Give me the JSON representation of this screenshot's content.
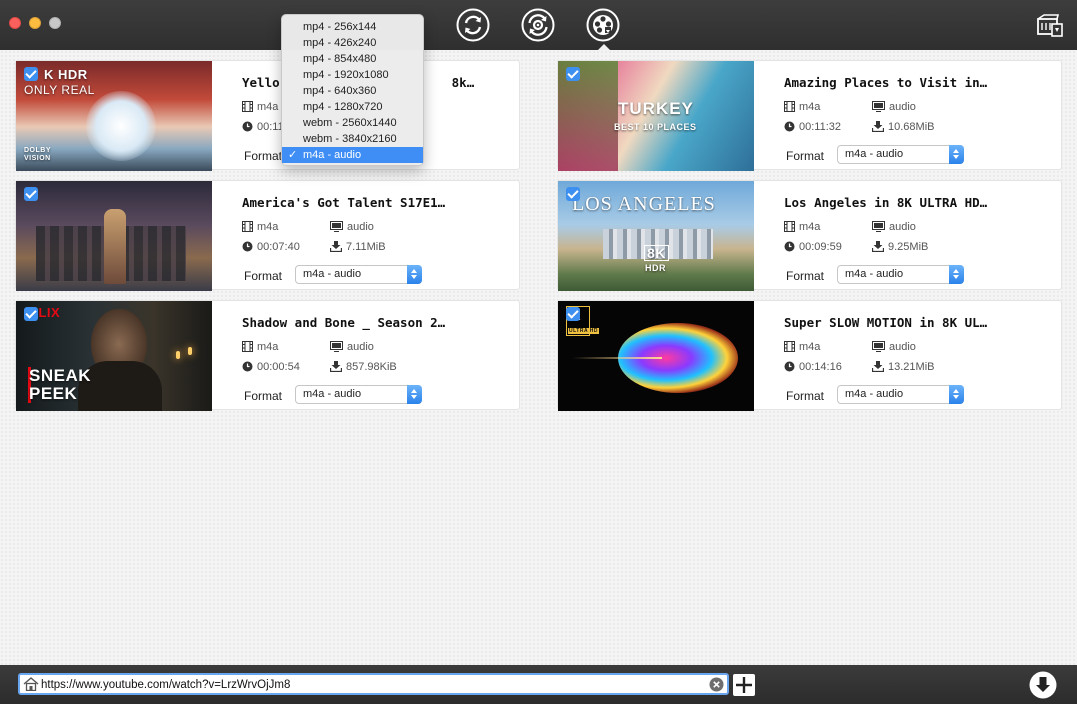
{
  "toolbar": {
    "buttons": [
      {
        "name": "convert",
        "icon": "refresh-arrows-icon"
      },
      {
        "name": "convert-settings",
        "icon": "refresh-gear-icon"
      },
      {
        "name": "download",
        "icon": "film-reel-download-icon",
        "active": true
      }
    ],
    "corner_icon": "film-clapper-icon"
  },
  "dropdown": {
    "options": [
      "mp4 - 256x144",
      "mp4 - 426x240",
      "mp4 - 854x480",
      "mp4 - 1920x1080",
      "mp4 - 640x360",
      "mp4 - 1280x720",
      "webm - 2560x1440",
      "webm - 3840x2160",
      "m4a - audio"
    ],
    "selected_index": 8
  },
  "videos": [
    {
      "title": "Yello",
      "title_tail": "8k…",
      "format_type": "m4a",
      "kind": "",
      "duration": "00:11",
      "size": "",
      "format_label": "Format",
      "format_value": "m4a - audio",
      "thumb_text": [
        "K HDR",
        "ONLY REAL",
        "DOLBY VISION"
      ]
    },
    {
      "title": "Amazing Places to Visit in…",
      "format_type": "m4a",
      "kind": "audio",
      "duration": "00:11:32",
      "size": "10.68MiB",
      "format_label": "Format",
      "format_value": "m4a - audio",
      "thumb_text": [
        "TURKEY",
        "BEST 10 PLACES"
      ]
    },
    {
      "title": "America's Got Talent S17E1…",
      "format_type": "m4a",
      "kind": "audio",
      "duration": "00:07:40",
      "size": "7.11MiB",
      "format_label": "Format",
      "format_value": "m4a - audio",
      "thumb_text": []
    },
    {
      "title": "Los Angeles in 8K ULTRA HD…",
      "format_type": "m4a",
      "kind": "audio",
      "duration": "00:09:59",
      "size": "9.25MiB",
      "format_label": "Format",
      "format_value": "m4a - audio",
      "thumb_text": [
        "LOS ANGELES",
        "8K",
        "HDR"
      ]
    },
    {
      "title": "Shadow and Bone _ Season 2…",
      "format_type": "m4a",
      "kind": "audio",
      "duration": "00:00:54",
      "size": "857.98KiB",
      "format_label": "Format",
      "format_value": "m4a - audio",
      "thumb_text": [
        "FLIX",
        "SNEAK",
        "PEEK"
      ]
    },
    {
      "title": "Super SLOW MOTION in 8K UL…",
      "format_type": "m4a",
      "kind": "audio",
      "duration": "00:14:16",
      "size": "13.21MiB",
      "format_label": "Format",
      "format_value": "m4a - audio",
      "thumb_text": [
        "K",
        "ULTRA HD"
      ]
    }
  ],
  "url_bar": {
    "value": "https://www.youtube.com/watch?v=LrzWrvOjJm8"
  },
  "colors": {
    "accent": "#3d8ff0",
    "titlebar": "#333333"
  }
}
